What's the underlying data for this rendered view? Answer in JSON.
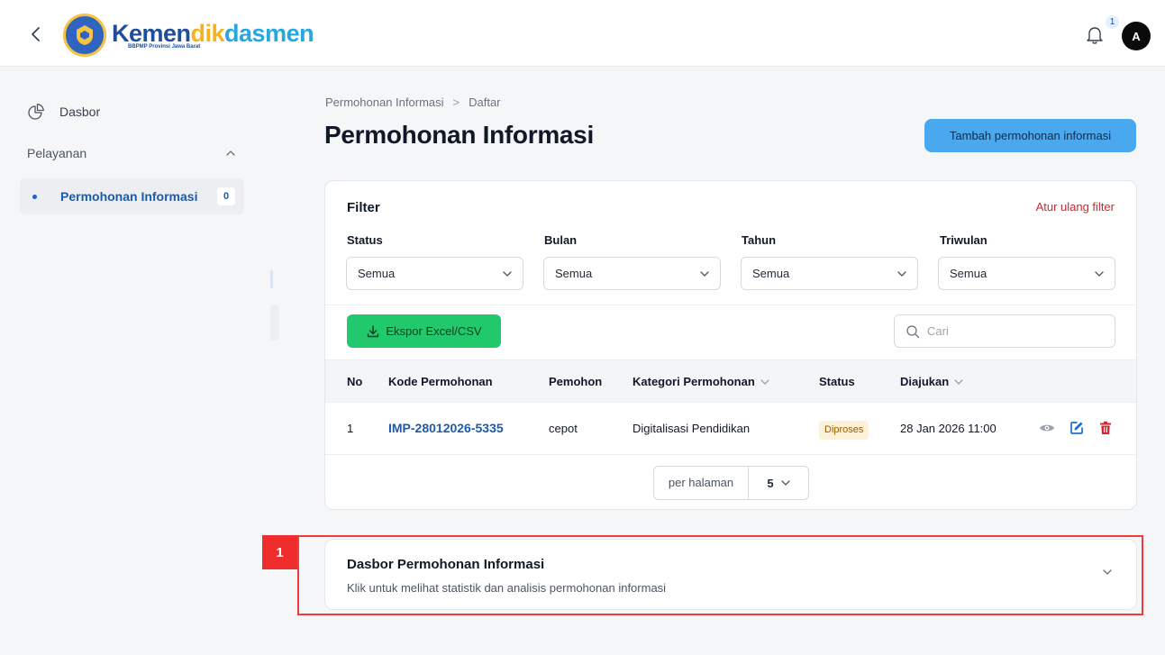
{
  "header": {
    "logo": {
      "part1": "Kemen",
      "part2": "dik",
      "part3": "dasmen",
      "subtitle": "BBPMP Provinsi Jawa Barat"
    },
    "notification_count": "1",
    "avatar_initial": "A"
  },
  "sidebar": {
    "dashboard_label": "Dasbor",
    "section_label": "Pelayanan",
    "items": [
      {
        "label": "Permohonan Informasi",
        "count": "0"
      }
    ]
  },
  "breadcrumb": [
    "Permohonan Informasi",
    ">",
    "Daftar"
  ],
  "page_title": "Permohonan Informasi",
  "add_button_label": "Tambah permohonan informasi",
  "filter": {
    "title": "Filter",
    "reset_label": "Atur ulang filter",
    "fields": [
      {
        "label": "Status",
        "value": "Semua"
      },
      {
        "label": "Bulan",
        "value": "Semua"
      },
      {
        "label": "Tahun",
        "value": "Semua"
      },
      {
        "label": "Triwulan",
        "value": "Semua"
      }
    ]
  },
  "toolbar": {
    "export_label": "Ekspor Excel/CSV",
    "search_placeholder": "Cari"
  },
  "table": {
    "headers": [
      "No",
      "Kode Permohonan",
      "Pemohon",
      "Kategori Permohonan",
      "Status",
      "Diajukan"
    ],
    "rows": [
      {
        "no": "1",
        "code": "IMP-28012026-5335",
        "requester": "cepot",
        "category": "Digitalisasi Pendidikan",
        "status": "Diproses",
        "submitted": "28 Jan 2026 11:00"
      }
    ]
  },
  "pagination": {
    "per_page_label": "per halaman",
    "per_page_value": "5"
  },
  "dashboard_panel": {
    "marker": "1",
    "title": "Dasbor Permohonan Informasi",
    "subtitle": "Klik untuk melihat statistik dan analisis permohonan informasi"
  },
  "colors": {
    "primary_blue": "#1f5aa6",
    "add_button": "#4aa8ef",
    "export_button": "#22c96c",
    "danger": "#d0262c",
    "highlight": "#ef3b3b"
  }
}
